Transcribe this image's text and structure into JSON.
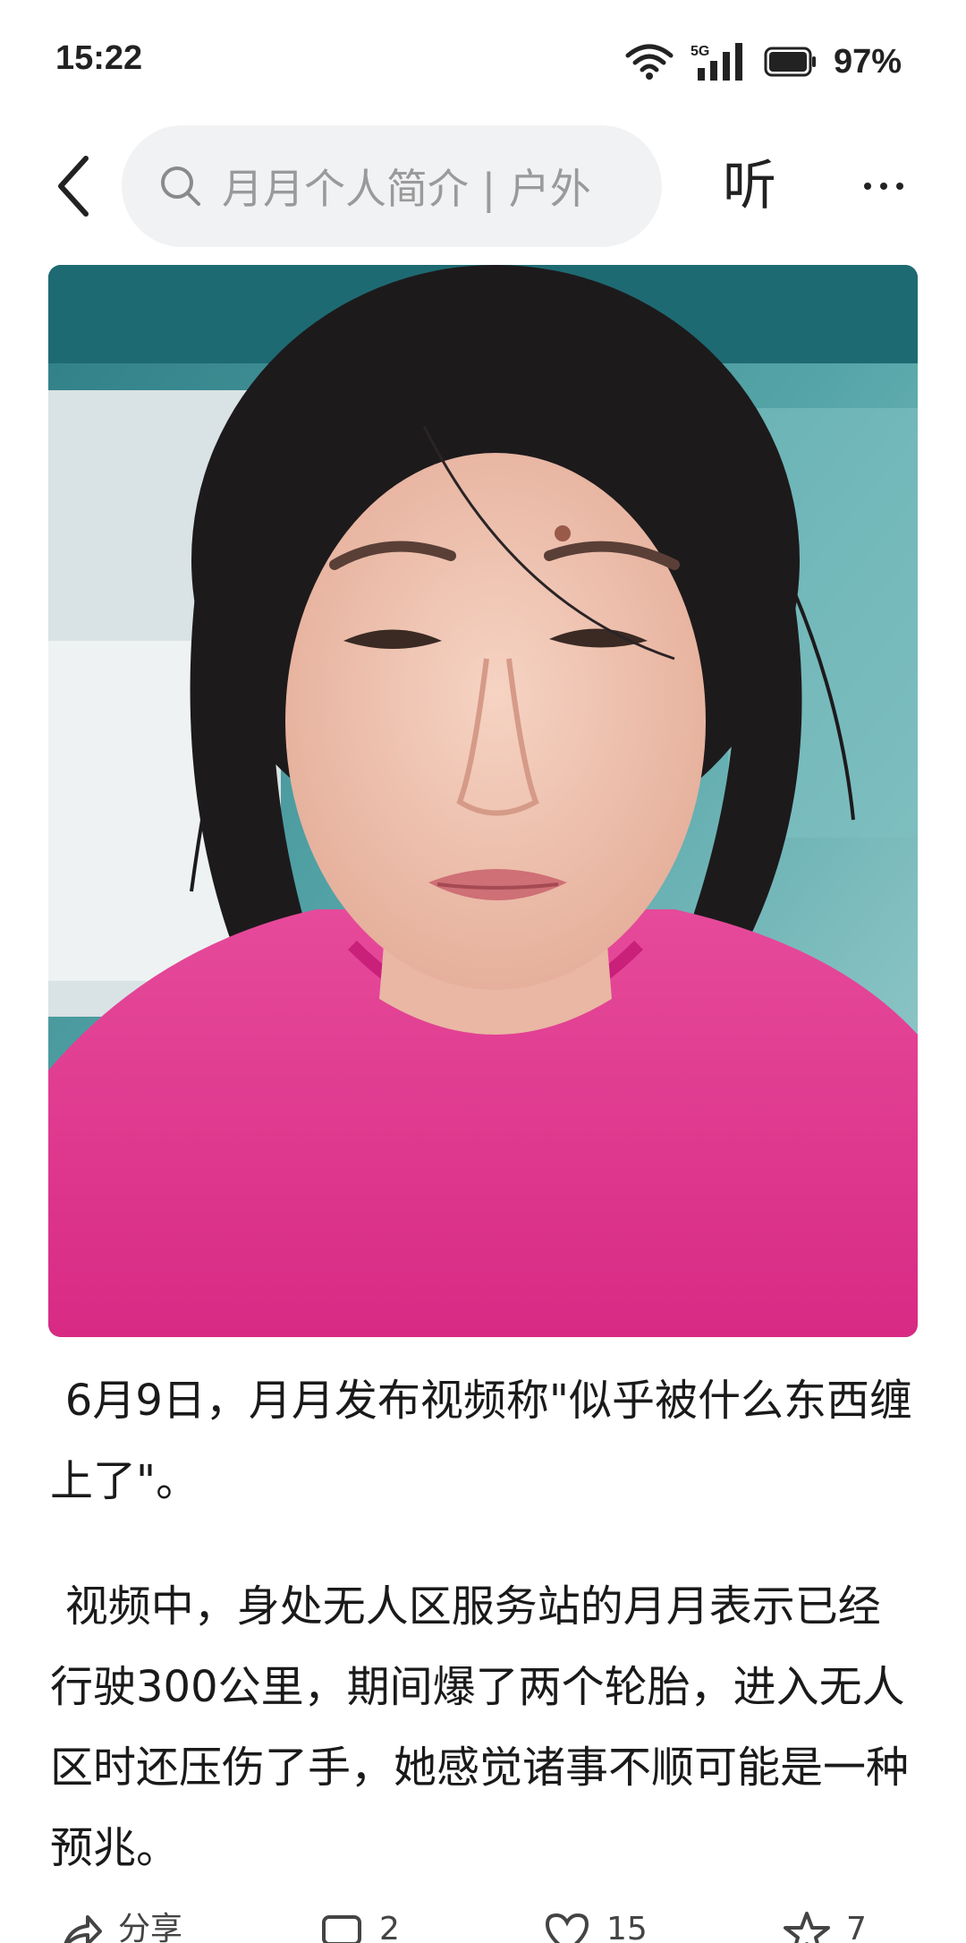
{
  "status_bar": {
    "time": "15:22",
    "network": "5G",
    "battery": "97%",
    "icons": [
      "wifi-icon",
      "cellular-5g-icon",
      "battery-icon"
    ]
  },
  "nav": {
    "back_icon": "back-chevron-icon",
    "search_placeholder": "月月个人简介 | 户外",
    "listen_label": "听",
    "more_icon": "more-dots-icon"
  },
  "article": {
    "paragraphs": [
      "6月9日，月月发布视频称\"似乎被什么东西缠上了\"。",
      "视频中，身处无人区服务站的月月表示已经行驶300公里，期间爆了两个轮胎，进入无人区时还压伤了手，她感觉诸事不顺可能是一种预兆。"
    ]
  },
  "actions": {
    "share_label": "分享",
    "comment_count": "2",
    "like_count": "15",
    "favorite_count": "7"
  },
  "colors": {
    "shirt": "#e0328c",
    "background_teal": "#3f8f95",
    "search_bg": "#f1f2f4"
  }
}
